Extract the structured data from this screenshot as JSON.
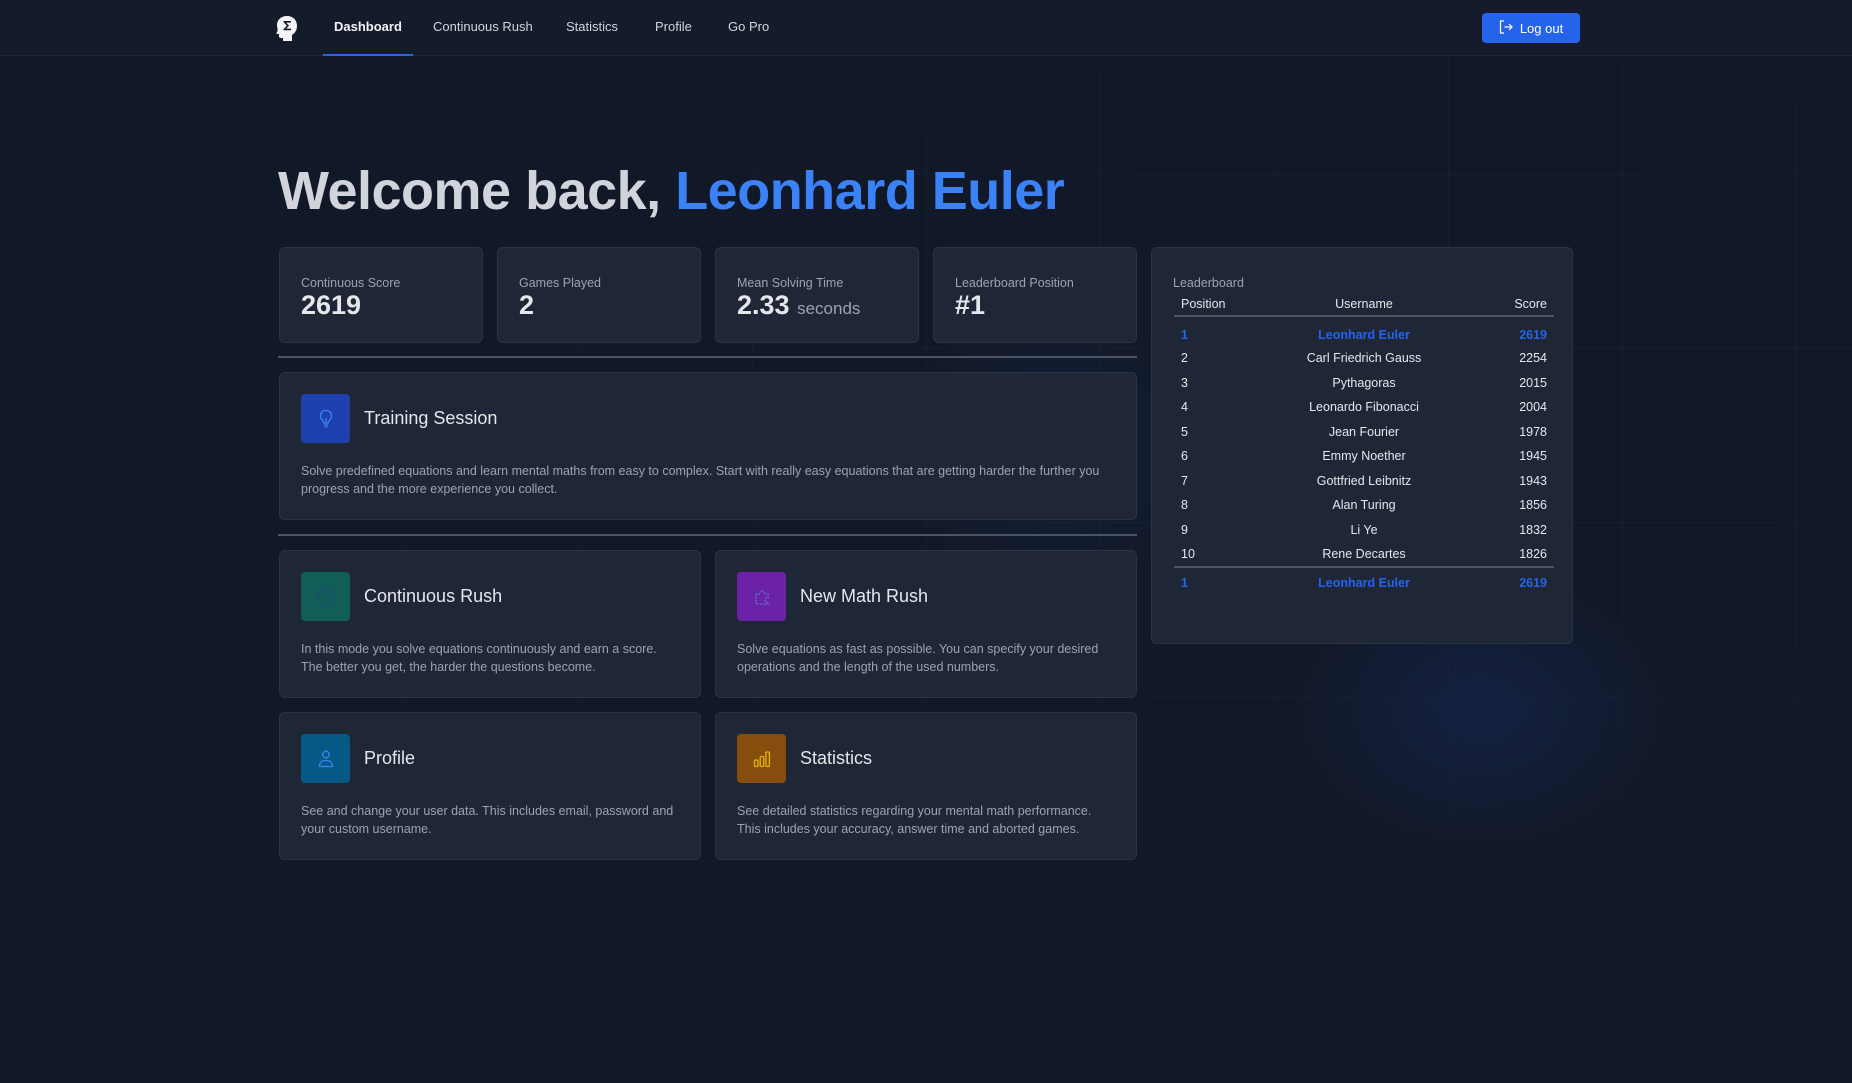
{
  "nav": {
    "logo_icon": "head-sigma-icon",
    "items": [
      {
        "label": "Dashboard",
        "active": true
      },
      {
        "label": "Continuous Rush",
        "active": false
      },
      {
        "label": "Statistics",
        "active": false
      },
      {
        "label": "Profile",
        "active": false
      },
      {
        "label": "Go Pro",
        "active": false
      }
    ],
    "logout": {
      "label": "Log out",
      "icon": "logout-icon"
    }
  },
  "welcome": {
    "prefix": "Welcome back, ",
    "username": "Leonhard Euler"
  },
  "stats": [
    {
      "label": "Continuous Score",
      "value": "2619",
      "unit": ""
    },
    {
      "label": "Games Played",
      "value": "2",
      "unit": ""
    },
    {
      "label": "Mean Solving Time",
      "value": "2.33",
      "unit": "seconds"
    },
    {
      "label": "Leaderboard Position",
      "value": "#1",
      "unit": ""
    }
  ],
  "features": {
    "training": {
      "title": "Training Session",
      "description": "Solve predefined equations and learn mental maths from easy to complex. Start with really easy equations that are getting harder the further you progress and the more experience you collect.",
      "icon": "lightbulb-icon",
      "icon_bg": "#1e40af",
      "icon_color": "#3b82f6"
    },
    "continuous_rush": {
      "title": "Continuous Rush",
      "description": "In this mode you solve equations continuously and earn a score. The better you get, the harder the questions become.",
      "icon": "clock-icon",
      "icon_bg": "#115e59",
      "icon_color": "#1e4a7a"
    },
    "new_math_rush": {
      "title": "New Math Rush",
      "description": "Solve equations as fast as possible. You can specify your desired operations and the length of the used numbers.",
      "icon": "puzzle-icon",
      "icon_bg": "#6b21a8",
      "icon_color": "#60a5fa"
    },
    "profile": {
      "title": "Profile",
      "description": "See and change your user data. This includes email, password and your custom username.",
      "icon": "user-icon",
      "icon_bg": "#075985",
      "icon_color": "#3b82f6"
    },
    "statistics": {
      "title": "Statistics",
      "description": "See detailed statistics regarding your mental math performance. This includes your accuracy, answer time and aborted games.",
      "icon": "bar-chart-icon",
      "icon_bg": "#854d0e",
      "icon_color": "#eab308"
    }
  },
  "leaderboard": {
    "title": "Leaderboard",
    "columns": [
      "Position",
      "Username",
      "Score"
    ],
    "rows": [
      {
        "position": "1",
        "username": "Leonhard Euler",
        "score": "2619",
        "is_current_user": true
      },
      {
        "position": "2",
        "username": "Carl Friedrich Gauss",
        "score": "2254",
        "is_current_user": false
      },
      {
        "position": "3",
        "username": "Pythagoras",
        "score": "2015",
        "is_current_user": false
      },
      {
        "position": "4",
        "username": "Leonardo Fibonacci",
        "score": "2004",
        "is_current_user": false
      },
      {
        "position": "5",
        "username": "Jean Fourier",
        "score": "1978",
        "is_current_user": false
      },
      {
        "position": "6",
        "username": "Emmy Noether",
        "score": "1945",
        "is_current_user": false
      },
      {
        "position": "7",
        "username": "Gottfried Leibnitz",
        "score": "1943",
        "is_current_user": false
      },
      {
        "position": "8",
        "username": "Alan Turing",
        "score": "1856",
        "is_current_user": false
      },
      {
        "position": "9",
        "username": "Li Ye",
        "score": "1832",
        "is_current_user": false
      },
      {
        "position": "10",
        "username": "Rene Decartes",
        "score": "1826",
        "is_current_user": false
      }
    ],
    "current_user": {
      "position": "1",
      "username": "Leonhard Euler",
      "score": "2619"
    }
  },
  "colors": {
    "accent": "#2563eb",
    "highlight_name": "#3b82f6",
    "background": "#111827",
    "card": "#1f2737"
  }
}
